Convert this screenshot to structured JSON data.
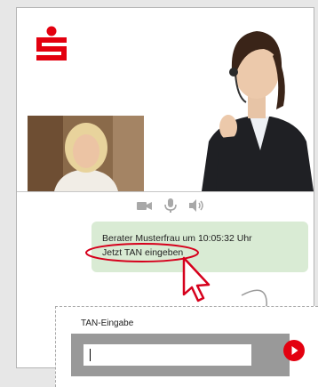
{
  "brand": {
    "logo_icon": "sparkasse-logo-icon",
    "color": "#e3000f"
  },
  "video": {
    "agent_image": "advisor-headset-photo",
    "self_image": "customer-webcam-photo"
  },
  "controls": {
    "icons": [
      "video-camera-icon",
      "microphone-icon",
      "speaker-icon"
    ]
  },
  "chat": {
    "line1": "Berater Musterfrau um 10:05:32 Uhr",
    "line2": "Jetzt TAN eingeben"
  },
  "tan": {
    "label": "TAN-Eingabe",
    "value": "",
    "submit_icon": "play-arrow-icon"
  },
  "colors": {
    "chat_bg": "#d9ebd4",
    "tan_bar": "#999999",
    "highlight": "#d6001c"
  }
}
